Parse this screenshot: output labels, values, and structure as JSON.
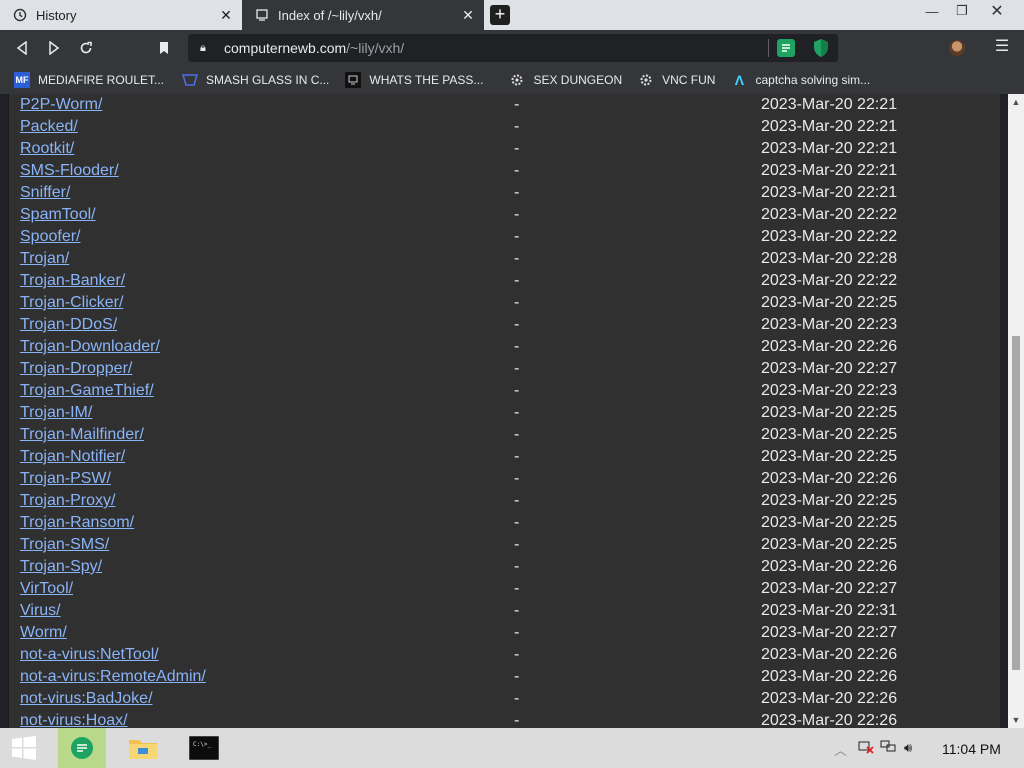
{
  "browser": {
    "tabs": [
      {
        "title": "History"
      },
      {
        "title": "Index of /~lily/vxh/"
      }
    ],
    "url": {
      "host": "computernewb.com",
      "path": "/~lily/vxh/"
    },
    "bookmarks": [
      {
        "label": "MEDIAFIRE ROULET...",
        "icon": "mf-icon",
        "badge": "MF"
      },
      {
        "label": "SMASH GLASS IN C...",
        "icon": "glass-icon"
      },
      {
        "label": "WHATS THE PASS...",
        "icon": "vnc-icon"
      },
      {
        "label": "SEX DUNGEON",
        "icon": "gear-icon"
      },
      {
        "label": "VNC FUN",
        "icon": "gear-icon"
      },
      {
        "label": "captcha solving sim...",
        "icon": "lambda-icon",
        "badge": "Λ"
      }
    ]
  },
  "listing": {
    "entries": [
      {
        "name": "P2P-Worm/",
        "size": "-",
        "modified": "2023-Mar-20 22:21"
      },
      {
        "name": "Packed/",
        "size": "-",
        "modified": "2023-Mar-20 22:21"
      },
      {
        "name": "Rootkit/",
        "size": "-",
        "modified": "2023-Mar-20 22:21"
      },
      {
        "name": "SMS-Flooder/",
        "size": "-",
        "modified": "2023-Mar-20 22:21"
      },
      {
        "name": "Sniffer/",
        "size": "-",
        "modified": "2023-Mar-20 22:21"
      },
      {
        "name": "SpamTool/",
        "size": "-",
        "modified": "2023-Mar-20 22:22"
      },
      {
        "name": "Spoofer/",
        "size": "-",
        "modified": "2023-Mar-20 22:22"
      },
      {
        "name": "Trojan/",
        "size": "-",
        "modified": "2023-Mar-20 22:28"
      },
      {
        "name": "Trojan-Banker/",
        "size": "-",
        "modified": "2023-Mar-20 22:22"
      },
      {
        "name": "Trojan-Clicker/",
        "size": "-",
        "modified": "2023-Mar-20 22:25"
      },
      {
        "name": "Trojan-DDoS/",
        "size": "-",
        "modified": "2023-Mar-20 22:23"
      },
      {
        "name": "Trojan-Downloader/",
        "size": "-",
        "modified": "2023-Mar-20 22:26"
      },
      {
        "name": "Trojan-Dropper/",
        "size": "-",
        "modified": "2023-Mar-20 22:27"
      },
      {
        "name": "Trojan-GameThief/",
        "size": "-",
        "modified": "2023-Mar-20 22:23"
      },
      {
        "name": "Trojan-IM/",
        "size": "-",
        "modified": "2023-Mar-20 22:25"
      },
      {
        "name": "Trojan-Mailfinder/",
        "size": "-",
        "modified": "2023-Mar-20 22:25"
      },
      {
        "name": "Trojan-Notifier/",
        "size": "-",
        "modified": "2023-Mar-20 22:25"
      },
      {
        "name": "Trojan-PSW/",
        "size": "-",
        "modified": "2023-Mar-20 22:26"
      },
      {
        "name": "Trojan-Proxy/",
        "size": "-",
        "modified": "2023-Mar-20 22:25"
      },
      {
        "name": "Trojan-Ransom/",
        "size": "-",
        "modified": "2023-Mar-20 22:25"
      },
      {
        "name": "Trojan-SMS/",
        "size": "-",
        "modified": "2023-Mar-20 22:25"
      },
      {
        "name": "Trojan-Spy/",
        "size": "-",
        "modified": "2023-Mar-20 22:26"
      },
      {
        "name": "VirTool/",
        "size": "-",
        "modified": "2023-Mar-20 22:27"
      },
      {
        "name": "Virus/",
        "size": "-",
        "modified": "2023-Mar-20 22:31"
      },
      {
        "name": "Worm/",
        "size": "-",
        "modified": "2023-Mar-20 22:27"
      },
      {
        "name": "not-a-virus:NetTool/",
        "size": "-",
        "modified": "2023-Mar-20 22:26"
      },
      {
        "name": "not-a-virus:RemoteAdmin/",
        "size": "-",
        "modified": "2023-Mar-20 22:26"
      },
      {
        "name": "not-virus:BadJoke/",
        "size": "-",
        "modified": "2023-Mar-20 22:26"
      },
      {
        "name": "not-virus:Hoax/",
        "size": "-",
        "modified": "2023-Mar-20 22:26"
      }
    ]
  },
  "taskbar": {
    "apps": [
      "start-icon",
      "notes-app-icon",
      "file-explorer-icon",
      "terminal-icon"
    ],
    "terminal_glyph": "C:\\>_",
    "clock": "11:04 PM"
  },
  "colors": {
    "link": "#8ab4f8",
    "accent_green": "#1ea362"
  }
}
